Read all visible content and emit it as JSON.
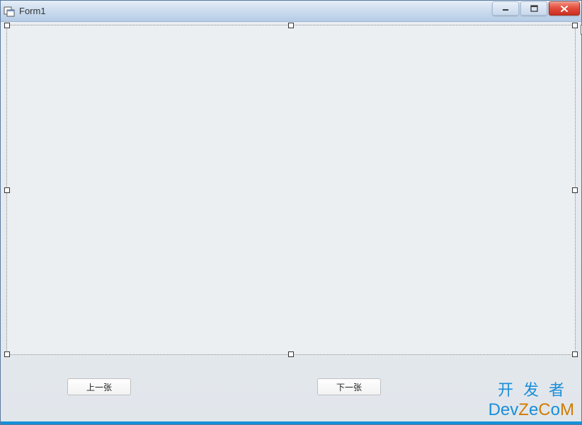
{
  "window": {
    "title": "Form1"
  },
  "buttons": {
    "prev": "上一张",
    "next": "下一张"
  },
  "watermark": {
    "line1": "开发者",
    "line2_parts": {
      "d": "D",
      "ev": "ev",
      "z": "Z",
      "e": "e",
      "c": "C",
      "o": "o",
      "m": "M"
    }
  }
}
